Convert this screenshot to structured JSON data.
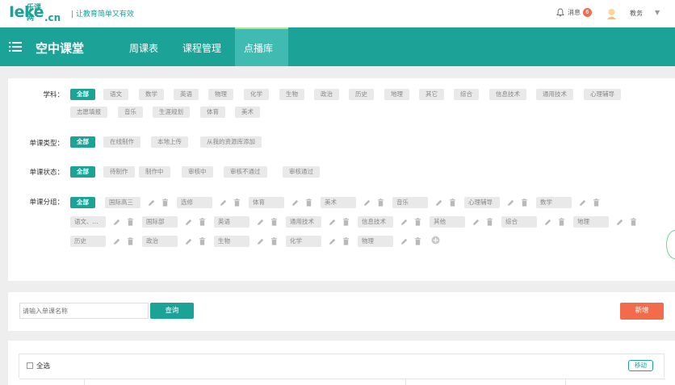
{
  "app": {
    "logo_main": "Ieke",
    "logo_small": "乐课网",
    "logo_sub": ".cn",
    "slogan": "| 让教育简单又有效"
  },
  "header": {
    "message_label": "消息",
    "message_count": "6",
    "user_name": "教务",
    "user_caret": "▼"
  },
  "nav": {
    "title": "空中课堂",
    "tabs": [
      {
        "label": "周课表"
      },
      {
        "label": "课程管理"
      },
      {
        "label": "点播库",
        "active": true
      }
    ]
  },
  "filters": {
    "subject": {
      "label": "学科：",
      "options": [
        "全部",
        "语文",
        "数学",
        "英语",
        "物理",
        "化学",
        "生物",
        "政治",
        "历史",
        "地理",
        "其它",
        "综合",
        "信息技术",
        "通用技术",
        "心理辅导",
        "志愿填报",
        "音乐",
        "生涯规划",
        "体育",
        "美术"
      ],
      "selected": "全部"
    },
    "type": {
      "label": "单课类型：",
      "options": [
        "全部",
        "在线制作",
        "本地上传",
        "从我的资源库添加"
      ],
      "selected": "全部"
    },
    "status": {
      "label": "单课状态：",
      "options": [
        "全部",
        "待制作",
        "制作中",
        "审核中",
        "审核不通过",
        "审核通过"
      ],
      "selected": "全部"
    },
    "group": {
      "label": "单课分组：",
      "all_label": "全部",
      "groups": [
        "国际高三",
        "选修",
        "体育",
        "美术",
        "音乐",
        "心理辅导",
        "数学",
        "语文、...",
        "国际部",
        "英语",
        "通用技术",
        "信息技术",
        "其他",
        "综合",
        "地理",
        "历史",
        "政治",
        "生物",
        "化学",
        "物理"
      ]
    }
  },
  "search": {
    "placeholder": "请输入单课名称",
    "search_label": "查询",
    "add_label": "新增"
  },
  "list": {
    "select_all_label": "全选",
    "move_label": "移动"
  },
  "colors": {
    "brand": "#1aa396",
    "accent": "#f26b4b",
    "nav_active": "#3fbbb1"
  }
}
